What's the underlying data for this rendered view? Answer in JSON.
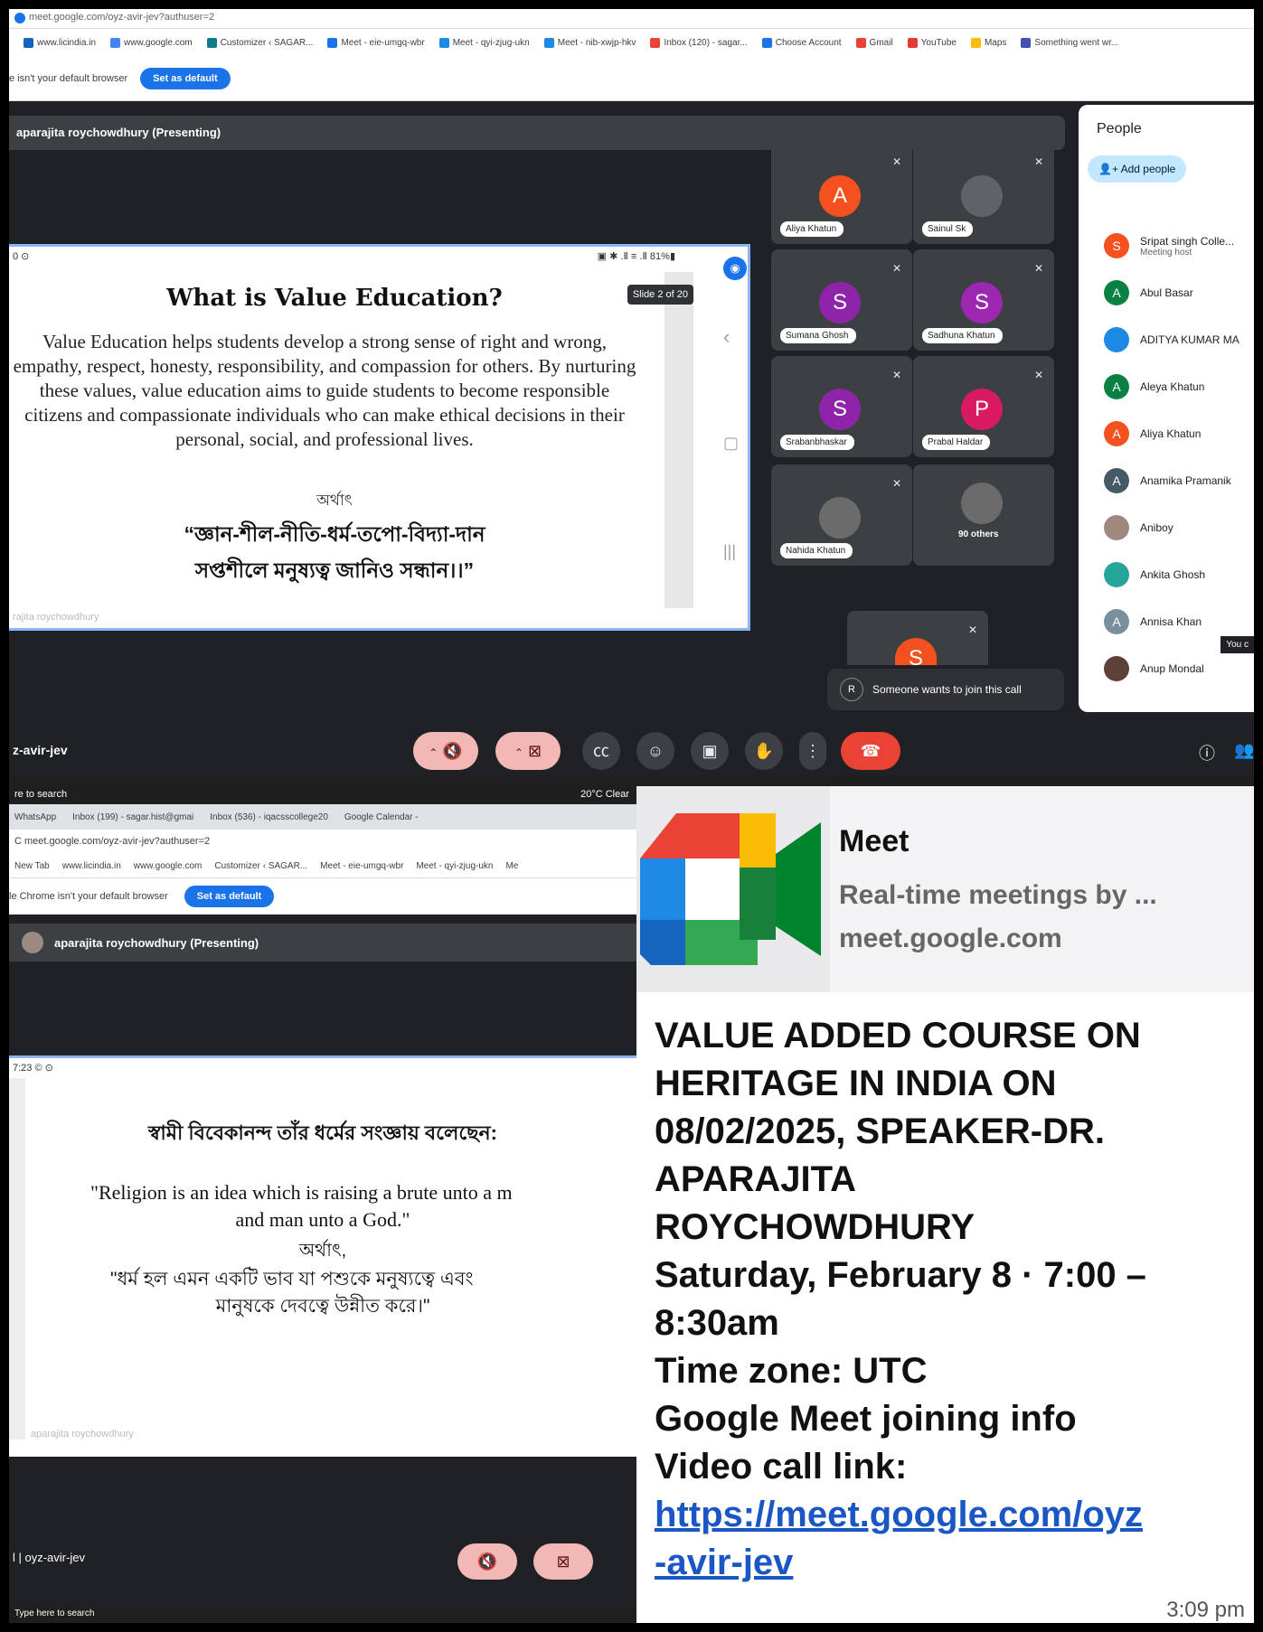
{
  "top_window": {
    "url": "meet.google.com/oyz-avir-jev?authuser=2",
    "bookmarks": [
      "www.licindia.in",
      "www.google.com",
      "Customizer ‹ SAGAR...",
      "Meet - eie-umgq-wbr",
      "Meet - qyi-zjug-ukn",
      "Meet - nib-xwjp-hkv",
      "Inbox (120) - sagar...",
      "Choose Account",
      "Gmail",
      "YouTube",
      "Maps",
      "Something went wr..."
    ],
    "default_browser_text": "e isn't your default browser",
    "set_default_label": "Set as default",
    "presenter": "aparajita roychowdhury (Presenting)",
    "slide": {
      "status_left": "0 ⊙",
      "status_right": "▣ ✱ .Ⅱ ≡ .Ⅱ 81%▮",
      "counter": "Slide 2 of 20",
      "title": "What is Value Education?",
      "body": "Value Education helps students develop a strong sense of right and wrong, empathy, respect, honesty, responsibility, and compassion for others. By nurturing these values, value education aims to guide students to become responsible citizens and compassionate individuals who can make ethical decisions in their personal, social, and professional lives.",
      "bn_small": "অর্থাৎ",
      "bn_line1": "“জ্ঞান-শীল-নীতি-ধর্ম-তপো-বিদ্যা-দান",
      "bn_line2": "সপ্তশীলে মনুষ্যত্ব জানিও সন্ধান।।”",
      "watermark": "rajita roychowdhury"
    },
    "tiles": [
      {
        "name": "Aliya Khatun",
        "initial": "A",
        "color": "#f4511e"
      },
      {
        "name": "Sainul Sk",
        "initial": "",
        "color": "#5f6368"
      },
      {
        "name": "Sumana Ghosh",
        "initial": "S",
        "color": "#8e24aa"
      },
      {
        "name": "Sadhuna Khatun",
        "initial": "S",
        "color": "#9c27b0"
      },
      {
        "name": "Srabanbhaskar",
        "initial": "S",
        "color": "#8e24aa"
      },
      {
        "name": "Prabal Haldar",
        "initial": "P",
        "color": "#d81b60"
      },
      {
        "name": "Nahida Khatun",
        "initial": "",
        "color": "#6b6b6b"
      },
      {
        "name": "90 others",
        "initial": "",
        "color": "#6b6b6b"
      }
    ],
    "self_tile_initial": "S",
    "people": {
      "title": "People",
      "add_label": "Add people",
      "list": [
        {
          "name": "Sripat singh Colle...",
          "sub": "Meeting host",
          "initial": "S",
          "color": "#f4511e"
        },
        {
          "name": "Abul Basar",
          "sub": "",
          "initial": "A",
          "color": "#0b8043"
        },
        {
          "name": "ADITYA KUMAR MA",
          "sub": "",
          "initial": "",
          "color": "#1e88e5"
        },
        {
          "name": "Aleya Khatun",
          "sub": "",
          "initial": "A",
          "color": "#0b8043"
        },
        {
          "name": "Aliya Khatun",
          "sub": "",
          "initial": "A",
          "color": "#f4511e"
        },
        {
          "name": "Anamika Pramanik",
          "sub": "",
          "initial": "A",
          "color": "#455a64"
        },
        {
          "name": "Aniboy",
          "sub": "",
          "initial": "",
          "color": "#a1887f"
        },
        {
          "name": "Ankita Ghosh",
          "sub": "",
          "initial": "",
          "color": "#26a69a"
        },
        {
          "name": "Annisa Khan",
          "sub": "",
          "initial": "A",
          "color": "#78909c"
        },
        {
          "name": "Anup Mondal",
          "sub": "",
          "initial": "",
          "color": "#5d4037"
        }
      ],
      "you_label": "You c"
    },
    "join_request": "Someone wants to join this call",
    "join_initial": "R",
    "meeting_code": "z-avir-jev",
    "taskbar_search": "re to search",
    "weather": "20°C Clear"
  },
  "bottom_left": {
    "taskbar": "WhatsApp",
    "tabs": [
      "Inbox (199) - sagar.hist@gmai",
      "Inbox (536) - iqacsscollege20",
      "Google Calendar -"
    ],
    "url": "meet.google.com/oyz-avir-jev?authuser=2",
    "bookmarks": [
      "New Tab",
      "www.licindia.in",
      "www.google.com",
      "Customizer ‹ SAGAR...",
      "Meet - eie-umgq-wbr",
      "Meet - qyi-zjug-ukn",
      "Me"
    ],
    "default_browser_text": "le Chrome isn't your default browser",
    "set_default_label": "Set as default",
    "presenter": "aparajita roychowdhury (Presenting)",
    "slide_status": "7:23 © ⊙",
    "bn_heading": "স্বামী বিবেকানন্দ তাঁর ধর্মের সংজ্ঞায় বলেছেন:",
    "quote1": "\"Religion is an idea which is raising a brute unto a m",
    "quote2": "and man unto a God.\"",
    "bn_small": "অর্থাৎ,",
    "bn_q1": "\"ধর্ম হল এমন একটি ভাব যা পশুকে মনুষ্যত্বে এবং",
    "bn_q2": "মানুষকে দেবত্বে উন্নীত করে।\"",
    "watermark": "aparajita roychowdhury",
    "meeting_code": "l | oyz-avir-jev",
    "taskbar_search": "Type here to search"
  },
  "message": {
    "card_title": "Meet",
    "card_desc": "Real-time meetings by ...",
    "card_domain": "meet.google.com",
    "lines": [
      "VALUE ADDED COURSE ON",
      "HERITAGE IN INDIA ON",
      "08/02/2025, SPEAKER-DR.",
      "APARAJITA",
      "ROYCHOWDHURY",
      "Saturday, February 8 · 7:00 –",
      "8:30am",
      "Time zone: UTC",
      "Google Meet joining info",
      "Video call link:"
    ],
    "link1": "https://meet.google.com/oyz",
    "link2": "-avir-jev",
    "time": "3:09 pm"
  }
}
